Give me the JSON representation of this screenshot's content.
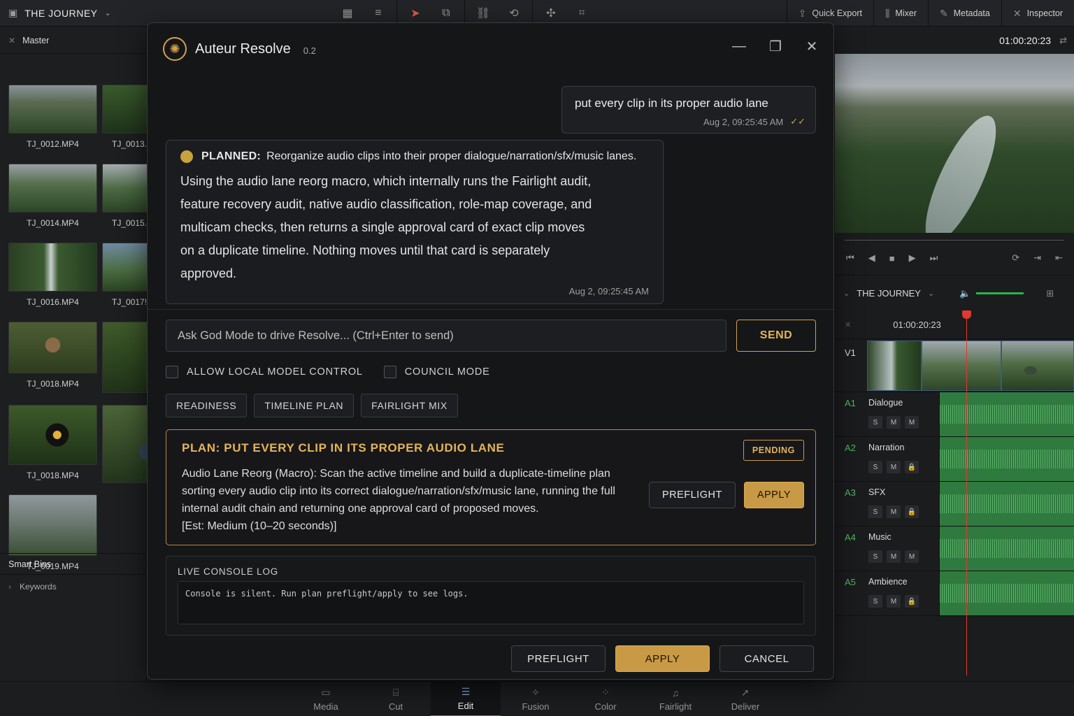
{
  "topbar": {
    "project_title": "THE JOURNEY",
    "right": [
      {
        "label": "Quick Export",
        "icon": "export-icon"
      },
      {
        "label": "Mixer",
        "icon": "mixer-icon"
      },
      {
        "label": "Metadata",
        "icon": "metadata-icon"
      },
      {
        "label": "Inspector",
        "icon": "inspector-icon"
      }
    ]
  },
  "media_pool": {
    "bin": "Master",
    "clips": [
      "TJ_0012.MP4",
      "TJ_0013.",
      "TJ_0014.MP4",
      "TJ_0015.",
      "TJ_0016.MP4",
      "TJ_0017!",
      "TJ_0018.MP4",
      "",
      "TJ_0018.MP4",
      "",
      "TJ_0019.MP4"
    ],
    "smart_bins": "Smart Bins",
    "keywords": "Keywords"
  },
  "viewer": {
    "timecode": "01:00:20:23",
    "timeline_name": "THE JOURNEY",
    "ruler_timecode": "01:00:20:23"
  },
  "timeline": {
    "video_track": "V1",
    "audio_tracks": [
      {
        "id": "A1",
        "name": "Dialogue"
      },
      {
        "id": "A2",
        "name": "Narration"
      },
      {
        "id": "A3",
        "name": "SFX"
      },
      {
        "id": "A4",
        "name": "Music"
      },
      {
        "id": "A5",
        "name": "Ambience"
      }
    ],
    "s_label": "S",
    "m_label": "M"
  },
  "modal": {
    "title": "Auteur Resolve",
    "version": "0.2",
    "user_message": {
      "text": "put every clip in its proper audio lane",
      "timestamp": "Aug 2, 09:25:45 AM"
    },
    "bot_message": {
      "status": "PLANNED:",
      "summary": "Reorganize audio clips into their proper dialogue/narration/sfx/music lanes.",
      "body": "Using the audio lane reorg macro, which internally runs the Fairlight audit, feature recovery audit, native audio classification, role-map coverage, and multicam checks, then returns a single approval card of exact clip moves on a duplicate timeline. Nothing moves until that card is separately approved.",
      "timestamp": "Aug 2, 09:25:45 AM"
    },
    "input_placeholder": "Ask God Mode to drive Resolve... (Ctrl+Enter to send)",
    "send_label": "SEND",
    "options": [
      {
        "label": "ALLOW LOCAL MODEL CONTROL",
        "checked": false
      },
      {
        "label": "COUNCIL MODE",
        "checked": false
      }
    ],
    "chips": [
      "READINESS",
      "TIMELINE PLAN",
      "FAIRLIGHT MIX"
    ],
    "plan": {
      "title": "PLAN: PUT EVERY CLIP IN ITS PROPER AUDIO LANE",
      "status": "PENDING",
      "description": "Audio Lane Reorg (Macro): Scan the active timeline and build a duplicate-timeline plan sorting every audio clip into its correct dialogue/narration/sfx/music lane, running the full internal audit chain and returning one approval card of proposed moves.",
      "estimate": "[Est: Medium (10–20 seconds)]",
      "preflight_label": "PREFLIGHT",
      "apply_label": "APPLY"
    },
    "console": {
      "title": "LIVE CONSOLE LOG",
      "text": "Console is silent. Run plan preflight/apply to see logs."
    },
    "footer": {
      "preflight": "PREFLIGHT",
      "apply": "APPLY",
      "cancel": "CANCEL"
    }
  },
  "pages": [
    {
      "label": "Media",
      "icon": "media-page-icon"
    },
    {
      "label": "Cut",
      "icon": "cut-page-icon"
    },
    {
      "label": "Edit",
      "icon": "edit-page-icon",
      "active": true
    },
    {
      "label": "Fusion",
      "icon": "fusion-page-icon"
    },
    {
      "label": "Color",
      "icon": "color-page-icon"
    },
    {
      "label": "Fairlight",
      "icon": "fairlight-page-icon"
    },
    {
      "label": "Deliver",
      "icon": "deliver-page-icon"
    }
  ],
  "colors": {
    "accent": "#c99a45",
    "playhead": "#e03a2f",
    "audio": "#2f7a3e"
  }
}
